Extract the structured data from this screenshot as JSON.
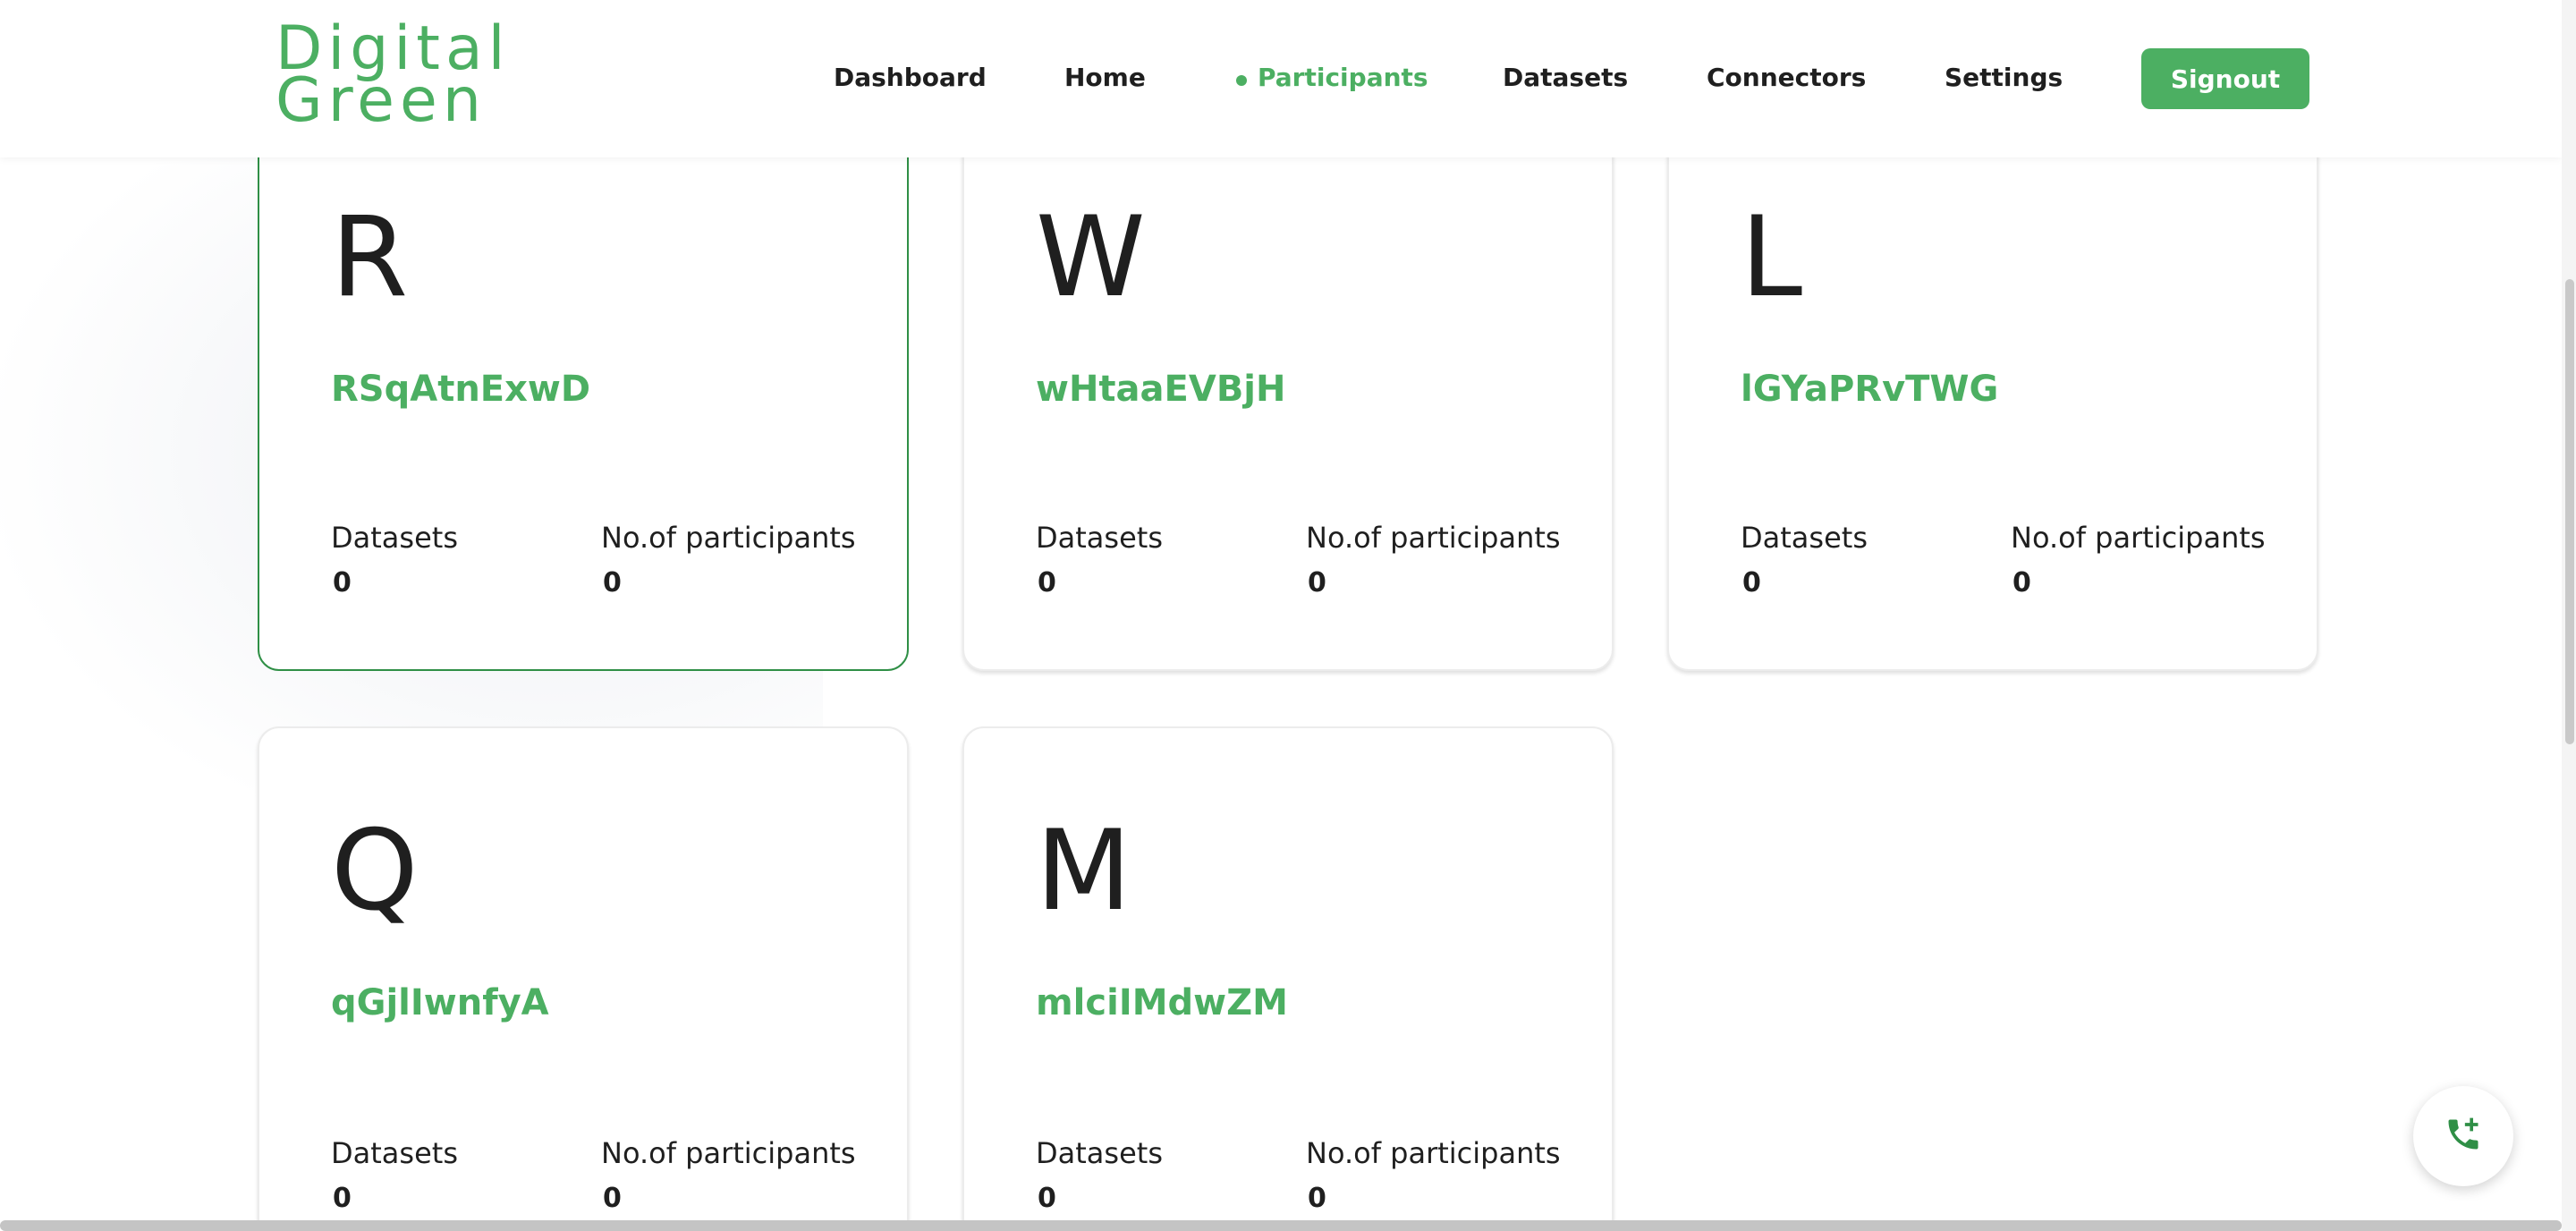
{
  "logo": {
    "line1": "Digital",
    "line2": "Green"
  },
  "nav": {
    "dashboard": "Dashboard",
    "home": "Home",
    "participants": "Participants",
    "datasets": "Datasets",
    "connectors": "Connectors",
    "settings": "Settings",
    "active": "participants"
  },
  "signout_label": "Signout",
  "accent_color": "#4caf62",
  "cards": [
    {
      "letter": "R",
      "name": "RSqAtnExwD",
      "datasets_label": "Datasets",
      "datasets": "0",
      "participants_label": "No.of participants",
      "participants": "0",
      "selected": true
    },
    {
      "letter": "W",
      "name": "wHtaaEVBjH",
      "datasets_label": "Datasets",
      "datasets": "0",
      "participants_label": "No.of participants",
      "participants": "0"
    },
    {
      "letter": "L",
      "name": "lGYaPRvTWG",
      "datasets_label": "Datasets",
      "datasets": "0",
      "participants_label": "No.of participants",
      "participants": "0"
    },
    {
      "letter": "Q",
      "name": "qGjlIwnfyA",
      "datasets_label": "Datasets",
      "datasets": "0",
      "participants_label": "No.of participants",
      "participants": "0"
    },
    {
      "letter": "M",
      "name": "mlciIMdwZM",
      "datasets_label": "Datasets",
      "datasets": "0",
      "participants_label": "No.of participants",
      "participants": "0"
    }
  ],
  "fab_icon": "phone-add-icon"
}
